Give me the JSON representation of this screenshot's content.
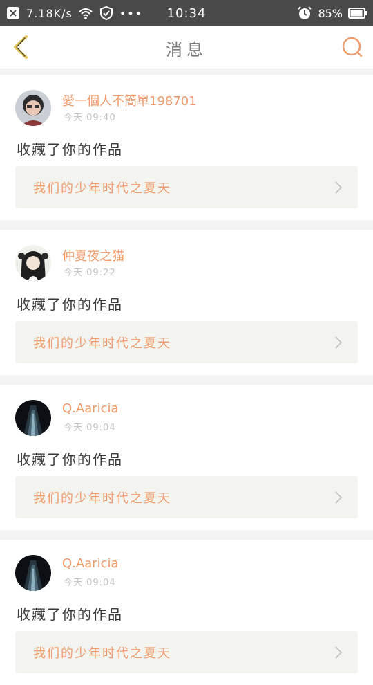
{
  "status_bar": {
    "speed": "7.18K/s",
    "time": "10:34",
    "battery": "85%"
  },
  "header": {
    "title": "消息"
  },
  "colors": {
    "accent": "#f09a6a",
    "back": "#e3c65b",
    "status_bg": "#4a4a4a",
    "page_bg": "#f3f3f3"
  },
  "messages": [
    {
      "username": "愛一個人不簡單198701",
      "time": "今天 09:40",
      "action": "收藏了你的作品",
      "work_title": "我们的少年时代之夏天"
    },
    {
      "username": "仲夏夜之猫",
      "time": "今天 09:22",
      "action": "收藏了你的作品",
      "work_title": "我们的少年时代之夏天"
    },
    {
      "username": "Q.Aaricia",
      "time": "今天 09:04",
      "action": "收藏了你的作品",
      "work_title": "我们的少年时代之夏天"
    },
    {
      "username": "Q.Aaricia",
      "time": "今天 09:04",
      "action": "收藏了你的作品",
      "work_title": "我们的少年时代之夏天"
    }
  ]
}
